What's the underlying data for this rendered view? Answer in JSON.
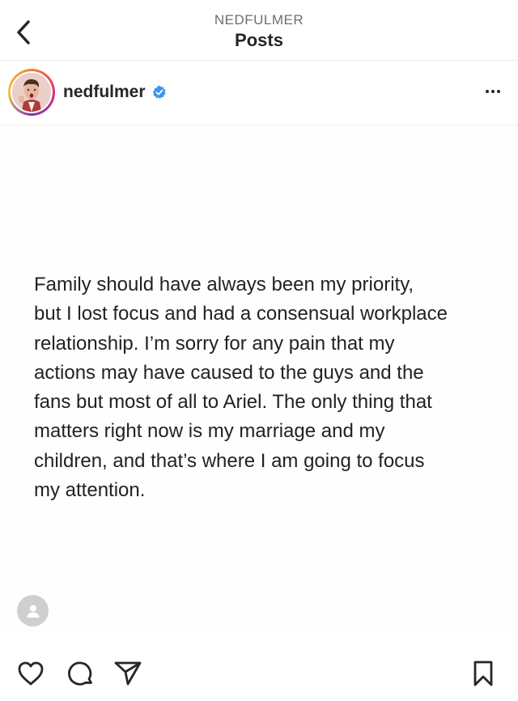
{
  "header": {
    "subtitle": "NEDFULMER",
    "title": "Posts"
  },
  "post": {
    "username": "nedfulmer",
    "verified": true,
    "caption": "Family should have always been my priority,\nbut I lost focus and had a consensual workplace\nrelationship.  I’m sorry for any pain that my\nactions may have caused to the guys and the\nfans but most of all to Ariel. The only thing that\nmatters right now is my marriage and my\nchildren, and that’s where I am going to focus\nmy attention."
  },
  "icons": {
    "back": "chevron-left-icon",
    "verified": "verified-badge-icon",
    "more": "more-dots-icon",
    "tagged": "person-icon",
    "like": "heart-icon",
    "comment": "comment-bubble-icon",
    "share": "paper-plane-icon",
    "save": "bookmark-icon"
  },
  "colors": {
    "verified_blue": "#3897f0",
    "text": "#262626",
    "subtle": "#6e6e6e"
  }
}
